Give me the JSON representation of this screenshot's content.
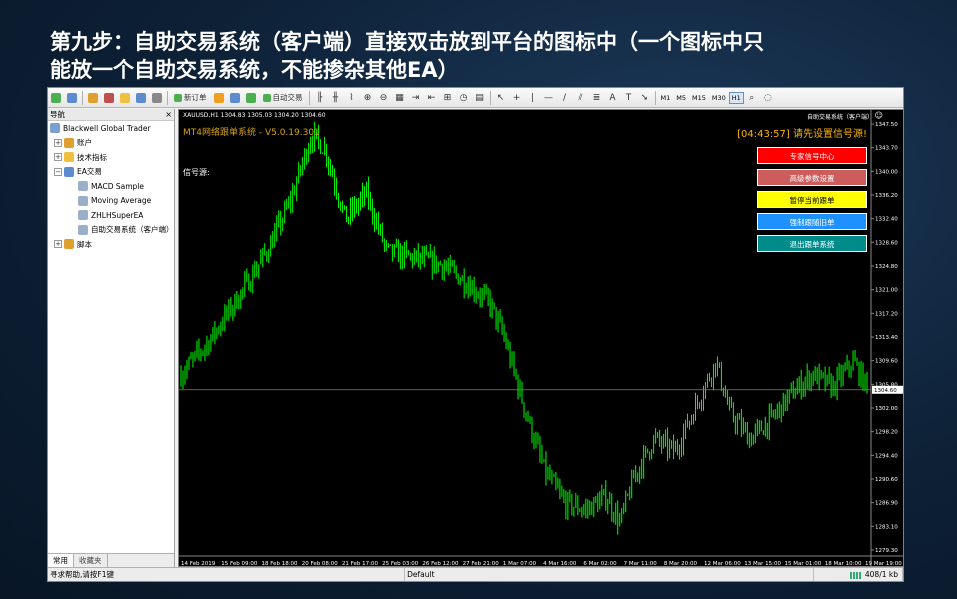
{
  "heading": {
    "line1": "第九步：自助交易系统（客户端）直接双击放到平台的图标中（一个图标中只",
    "line2": "能放一个自助交易系统，不能掺杂其他EA）"
  },
  "toolbar": {
    "new_order": "新订单",
    "auto_trading": "自动交易",
    "timeframes": [
      "M1",
      "M5",
      "M15",
      "M30",
      "H1"
    ],
    "active_timeframe": "H1"
  },
  "navigator": {
    "title": "导航",
    "close": "×",
    "items": [
      {
        "label": "Blackwell Global Trader",
        "level": 0,
        "icon": "folder-icon"
      },
      {
        "label": "账户",
        "level": 1,
        "icon": "accounts-icon"
      },
      {
        "label": "技术指标",
        "level": 1,
        "icon": "indicators-icon"
      },
      {
        "label": "EA交易",
        "level": 1,
        "icon": "expert-advisors-icon"
      },
      {
        "label": "MACD Sample",
        "level": 2,
        "icon": "ea-icon"
      },
      {
        "label": "Moving Average",
        "level": 2,
        "icon": "ea-icon"
      },
      {
        "label": "ZHLHSuperEA",
        "level": 2,
        "icon": "ea-icon"
      },
      {
        "label": "自助交易系统（客户端）",
        "level": 2,
        "icon": "ea-icon"
      },
      {
        "label": "脚本",
        "level": 1,
        "icon": "scripts-icon"
      }
    ],
    "tabs": [
      "常用",
      "收藏夹"
    ]
  },
  "chart": {
    "symbol_info": "XAUUSD,H1  1304.83 1305.03 1304.20 1304.60",
    "ea_name": "自助交易系统（客户端）",
    "system_title": "MT4网络跟单系统 - V5.0.19.301",
    "signal_label": "信号源:",
    "timer": "[04:43:57] 请先设置信号源!",
    "buttons": [
      {
        "label": "专家信号中心",
        "color": "#ff0000"
      },
      {
        "label": "高级参数设置",
        "color": "#cd5c5c"
      },
      {
        "label": "暂停当前跟单",
        "color": "#ffff00",
        "text_color": "#000000"
      },
      {
        "label": "强制跟随旧单",
        "color": "#1e90ff"
      },
      {
        "label": "退出跟单系统",
        "color": "#008b8b"
      }
    ],
    "current_price": "1304.60",
    "price_ticks": [
      "1347.50",
      "1343.70",
      "1340.00",
      "1336.20",
      "1332.40",
      "1328.60",
      "1324.80",
      "1321.00",
      "1317.20",
      "1313.40",
      "1309.60",
      "1305.80",
      "1302.00",
      "1298.20",
      "1294.40",
      "1290.60",
      "1286.90",
      "1283.10",
      "1279.30"
    ],
    "time_ticks": [
      "14 Feb 2019",
      "15 Feb 09:00",
      "18 Feb 18:00",
      "20 Feb 08:00",
      "21 Feb 17:00",
      "25 Feb 03:00",
      "26 Feb 12:00",
      "27 Feb 21:00",
      "1 Mar 07:00",
      "4 Mar 16:00",
      "6 Mar 02:00",
      "7 Mar 11:00",
      "8 Mar 20:00",
      "12 Mar 06:00",
      "13 Mar 15:00",
      "15 Mar 01:00",
      "18 Mar 10:00",
      "19 Mar 19:00"
    ],
    "price_range": [
      1279.3,
      1347.5
    ],
    "candle_color": "#00ff00",
    "bg_color": "#000000"
  },
  "statusbar": {
    "help": "寻求帮助,请按F1键",
    "profile": "Default",
    "traffic": "408/1 kb"
  }
}
